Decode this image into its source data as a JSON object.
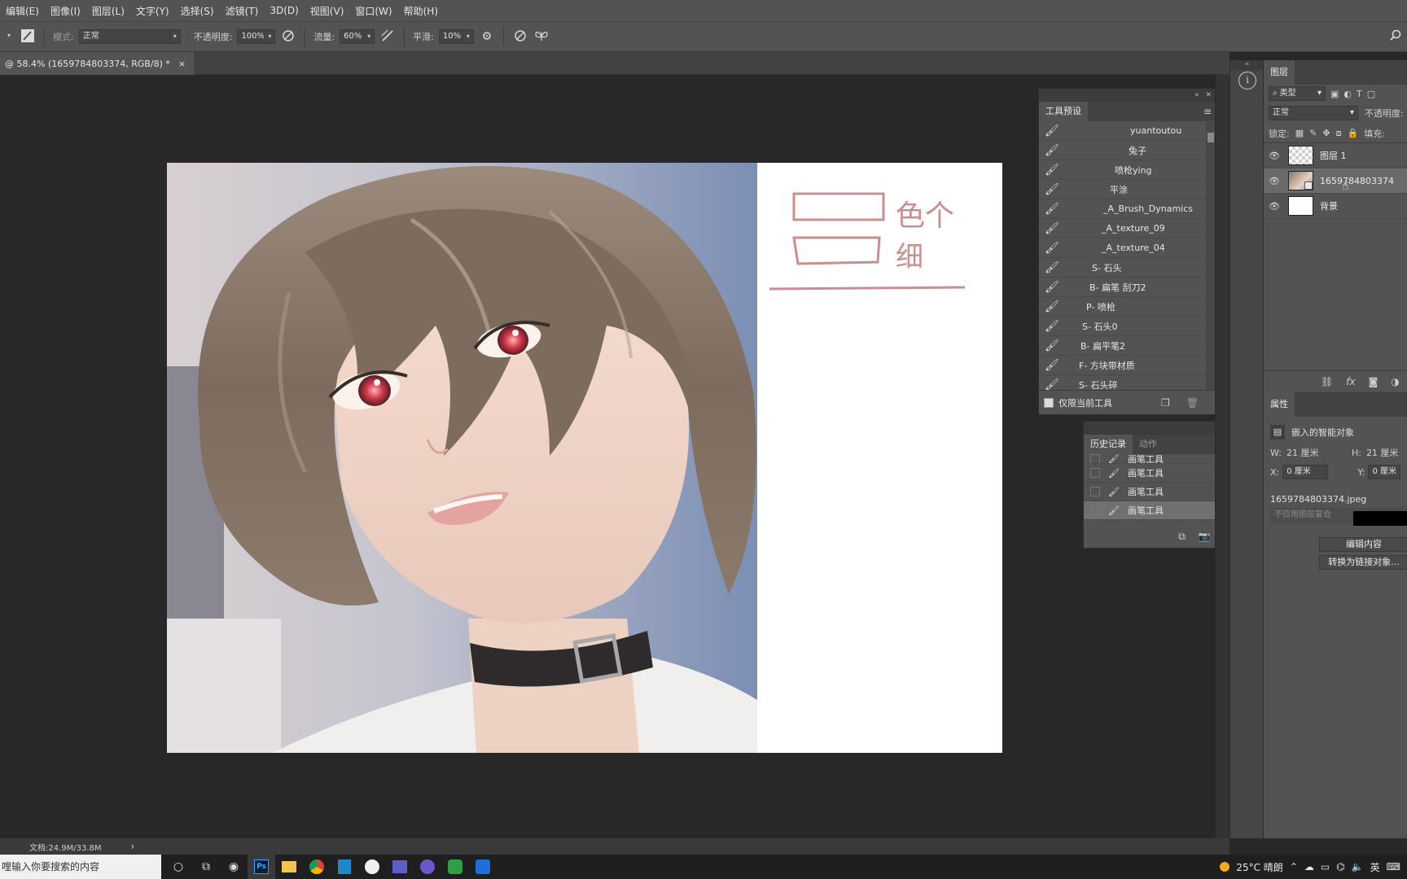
{
  "menubar": {
    "items": [
      "编辑(E)",
      "图像(I)",
      "图层(L)",
      "文字(Y)",
      "选择(S)",
      "滤镜(T)",
      "3D(D)",
      "视图(V)",
      "窗口(W)",
      "帮助(H)"
    ]
  },
  "options": {
    "mode_label": "模式:",
    "mode_value": "正常",
    "opacity_label": "不透明度:",
    "opacity_value": "100%",
    "flow_label": "流量:",
    "flow_value": "60%",
    "smooth_label": "平滑:",
    "smooth_value": "10%"
  },
  "document": {
    "tab_title": "@ 58.4% (1659784803374, RGB/8) *",
    "close_glyph": "×"
  },
  "status": {
    "doc_size": "文档:24.9M/33.8M",
    "arrow": "›"
  },
  "tool_presets": {
    "title": "工具预设",
    "items": [
      "yuantoutou",
      "兔子",
      "喷枪ying",
      "平涂",
      "_A_Brush_Dynamics",
      "_A_texture_09",
      "_A_texture_04",
      "S- 石头",
      "B- 扁笔 刮刀2",
      "P- 喷枪",
      "S- 石头0",
      "B- 扁平笔2",
      "F- 方块带材质",
      "S- 石头碎"
    ],
    "current_tool_only_label": "仅限当前工具",
    "current_tool_only_checked": true
  },
  "history": {
    "tabs": [
      "历史记录",
      "动作"
    ],
    "partial_item": "画笔工具",
    "items": [
      "画笔工具",
      "画笔工具",
      "画笔工具"
    ],
    "selected_index": 2
  },
  "layers": {
    "tab": "图层",
    "filter_kind": "类型",
    "blend_mode": "正常",
    "opacity_label": "不透明度:",
    "lock_label": "锁定:",
    "fill_label": "填充:",
    "items": [
      {
        "name": "图层 1",
        "thumb": "transparent"
      },
      {
        "name": "1659784803374",
        "thumb": "photo",
        "selected": true
      },
      {
        "name": "背景",
        "thumb": "white"
      }
    ]
  },
  "properties": {
    "tab": "属性",
    "object_type": "嵌入的智能对象",
    "w_label": "W:",
    "w_value": "21 厘米",
    "h_label": "H:",
    "h_value": "21 厘米",
    "x_label": "X:",
    "x_value": "0 厘米",
    "y_label": "Y:",
    "y_value": "0 厘米",
    "filename": "1659784803374.jpeg",
    "comp_placeholder": "不应用图层复合",
    "edit_contents": "编辑内容",
    "convert_linked": "转换为链接对象..."
  },
  "canvas_notes": {
    "line1": "色个",
    "line2": "细"
  },
  "taskbar": {
    "search_placeholder": "哩输入你要搜索的内容",
    "weather": "25°C 晴朗",
    "ime": "英"
  },
  "colors": {
    "ui_panel": "#535353",
    "workspace": "#282828",
    "sketch_ink": "#c98f8f",
    "photo_bg_blue": "#7b8eb4",
    "hair_brown": "#7d6b5e",
    "eye_red": "#d23a4a"
  }
}
